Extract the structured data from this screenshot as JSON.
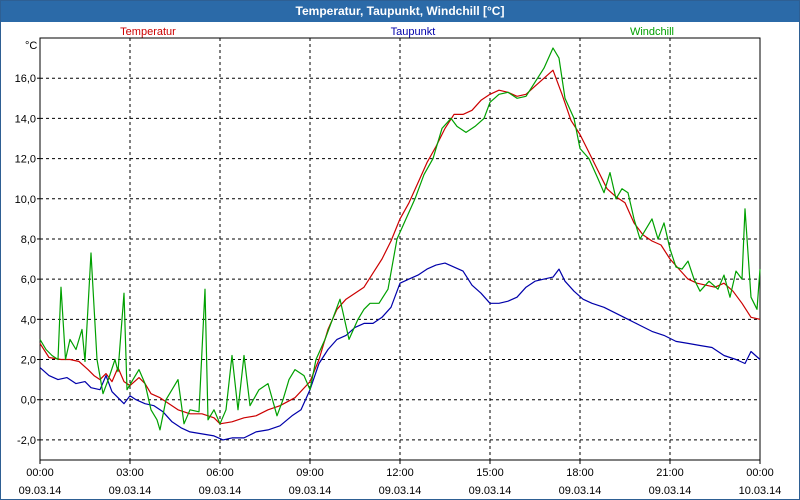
{
  "window": {
    "title": "Temperatur, Taupunkt, Windchill [°C]"
  },
  "chart_data": {
    "type": "line",
    "title": "Temperatur, Taupunkt, Windchill [°C]",
    "ylabel": "°C",
    "ylim": [
      -3,
      18
    ],
    "xlim": [
      0,
      24
    ],
    "yticks": [
      -2,
      0,
      2,
      4,
      6,
      8,
      10,
      12,
      14,
      16
    ],
    "ytick_labels": [
      "-2,0",
      "0,0",
      "2,0",
      "4,0",
      "6,0",
      "8,0",
      "10,0",
      "12,0",
      "14,0",
      "16,0"
    ],
    "xticks": [
      0,
      3,
      6,
      9,
      12,
      15,
      18,
      21,
      24
    ],
    "xtick_labels": [
      [
        "00:00",
        "09.03.14"
      ],
      [
        "03:00",
        "09.03.14"
      ],
      [
        "06:00",
        "09.03.14"
      ],
      [
        "09:00",
        "09.03.14"
      ],
      [
        "12:00",
        "09.03.14"
      ],
      [
        "15:00",
        "09.03.14"
      ],
      [
        "18:00",
        "09.03.14"
      ],
      [
        "21:00",
        "09.03.14"
      ],
      [
        "00:00",
        "10.03.14"
      ]
    ],
    "grid": true,
    "legend_position": "top",
    "series": [
      {
        "name": "Temperatur",
        "color": "#cc0000",
        "points": [
          [
            0,
            2.8
          ],
          [
            0.3,
            2.1
          ],
          [
            0.7,
            2.0
          ],
          [
            1.0,
            2.0
          ],
          [
            1.3,
            1.9
          ],
          [
            1.6,
            1.5
          ],
          [
            1.8,
            1.2
          ],
          [
            2.0,
            1.0
          ],
          [
            2.2,
            1.3
          ],
          [
            2.4,
            0.9
          ],
          [
            2.6,
            1.6
          ],
          [
            2.8,
            0.9
          ],
          [
            3.0,
            0.7
          ],
          [
            3.3,
            1.1
          ],
          [
            3.5,
            0.8
          ],
          [
            3.7,
            0.3
          ],
          [
            4.0,
            0.1
          ],
          [
            4.3,
            -0.2
          ],
          [
            4.6,
            -0.5
          ],
          [
            5.0,
            -0.7
          ],
          [
            5.4,
            -0.7
          ],
          [
            5.8,
            -0.9
          ],
          [
            6.0,
            -1.2
          ],
          [
            6.4,
            -1.1
          ],
          [
            6.8,
            -0.9
          ],
          [
            7.2,
            -0.8
          ],
          [
            7.6,
            -0.5
          ],
          [
            8.0,
            -0.3
          ],
          [
            8.5,
            0.1
          ],
          [
            9.0,
            0.9
          ],
          [
            9.3,
            2.0
          ],
          [
            9.6,
            3.5
          ],
          [
            9.9,
            4.5
          ],
          [
            10.2,
            5.0
          ],
          [
            10.5,
            5.3
          ],
          [
            10.8,
            5.6
          ],
          [
            11.1,
            6.3
          ],
          [
            11.4,
            7.0
          ],
          [
            11.7,
            7.9
          ],
          [
            12.0,
            9.0
          ],
          [
            12.3,
            9.8
          ],
          [
            12.6,
            10.8
          ],
          [
            12.9,
            11.8
          ],
          [
            13.2,
            12.6
          ],
          [
            13.5,
            13.5
          ],
          [
            13.8,
            14.2
          ],
          [
            14.1,
            14.2
          ],
          [
            14.4,
            14.4
          ],
          [
            14.7,
            14.9
          ],
          [
            15.0,
            15.2
          ],
          [
            15.3,
            15.4
          ],
          [
            15.6,
            15.3
          ],
          [
            15.9,
            15.1
          ],
          [
            16.2,
            15.2
          ],
          [
            16.5,
            15.6
          ],
          [
            16.8,
            16.0
          ],
          [
            17.1,
            16.4
          ],
          [
            17.4,
            15.2
          ],
          [
            17.7,
            13.9
          ],
          [
            18.0,
            13.2
          ],
          [
            18.3,
            12.3
          ],
          [
            18.6,
            11.4
          ],
          [
            18.9,
            10.5
          ],
          [
            19.2,
            10.1
          ],
          [
            19.5,
            9.8
          ],
          [
            19.8,
            8.8
          ],
          [
            20.1,
            8.2
          ],
          [
            20.4,
            7.9
          ],
          [
            20.7,
            7.7
          ],
          [
            21.0,
            7.0
          ],
          [
            21.3,
            6.5
          ],
          [
            21.6,
            6.0
          ],
          [
            21.9,
            5.8
          ],
          [
            22.2,
            5.7
          ],
          [
            22.5,
            5.6
          ],
          [
            22.8,
            5.8
          ],
          [
            23.1,
            5.4
          ],
          [
            23.4,
            4.8
          ],
          [
            23.7,
            4.1
          ],
          [
            24.0,
            4.0
          ]
        ]
      },
      {
        "name": "Taupunkt",
        "color": "#0000aa",
        "points": [
          [
            0,
            1.6
          ],
          [
            0.3,
            1.2
          ],
          [
            0.6,
            1.0
          ],
          [
            0.9,
            1.1
          ],
          [
            1.2,
            0.8
          ],
          [
            1.5,
            0.9
          ],
          [
            1.7,
            0.6
          ],
          [
            2.0,
            0.5
          ],
          [
            2.2,
            1.2
          ],
          [
            2.4,
            0.4
          ],
          [
            2.6,
            0.1
          ],
          [
            2.8,
            -0.2
          ],
          [
            3.0,
            0.2
          ],
          [
            3.2,
            0.0
          ],
          [
            3.5,
            -0.2
          ],
          [
            3.8,
            -0.3
          ],
          [
            4.1,
            -0.6
          ],
          [
            4.4,
            -1.1
          ],
          [
            4.7,
            -1.4
          ],
          [
            5.0,
            -1.6
          ],
          [
            5.4,
            -1.7
          ],
          [
            5.8,
            -1.8
          ],
          [
            6.1,
            -2.0
          ],
          [
            6.4,
            -1.9
          ],
          [
            6.8,
            -1.9
          ],
          [
            7.2,
            -1.6
          ],
          [
            7.6,
            -1.5
          ],
          [
            8.0,
            -1.3
          ],
          [
            8.4,
            -0.8
          ],
          [
            8.7,
            -0.5
          ],
          [
            9.0,
            0.5
          ],
          [
            9.3,
            1.8
          ],
          [
            9.6,
            2.5
          ],
          [
            9.9,
            3.0
          ],
          [
            10.2,
            3.2
          ],
          [
            10.5,
            3.6
          ],
          [
            10.8,
            3.8
          ],
          [
            11.1,
            3.8
          ],
          [
            11.4,
            4.1
          ],
          [
            11.7,
            4.6
          ],
          [
            12.0,
            5.8
          ],
          [
            12.3,
            6.0
          ],
          [
            12.6,
            6.2
          ],
          [
            12.9,
            6.5
          ],
          [
            13.2,
            6.7
          ],
          [
            13.5,
            6.8
          ],
          [
            13.8,
            6.6
          ],
          [
            14.1,
            6.4
          ],
          [
            14.4,
            5.7
          ],
          [
            14.7,
            5.3
          ],
          [
            15.0,
            4.8
          ],
          [
            15.3,
            4.8
          ],
          [
            15.6,
            4.9
          ],
          [
            15.9,
            5.1
          ],
          [
            16.2,
            5.6
          ],
          [
            16.5,
            5.9
          ],
          [
            16.8,
            6.0
          ],
          [
            17.1,
            6.1
          ],
          [
            17.3,
            6.5
          ],
          [
            17.5,
            5.9
          ],
          [
            17.8,
            5.4
          ],
          [
            18.1,
            5.0
          ],
          [
            18.4,
            4.8
          ],
          [
            18.8,
            4.6
          ],
          [
            19.2,
            4.3
          ],
          [
            19.6,
            4.0
          ],
          [
            20.0,
            3.7
          ],
          [
            20.4,
            3.4
          ],
          [
            20.8,
            3.2
          ],
          [
            21.2,
            2.9
          ],
          [
            21.6,
            2.8
          ],
          [
            22.0,
            2.7
          ],
          [
            22.4,
            2.6
          ],
          [
            22.8,
            2.2
          ],
          [
            23.2,
            2.0
          ],
          [
            23.5,
            1.8
          ],
          [
            23.7,
            2.4
          ],
          [
            24.0,
            2.0
          ]
        ]
      },
      {
        "name": "Windchill",
        "color": "#00a000",
        "points": [
          [
            0,
            3.0
          ],
          [
            0.2,
            2.5
          ],
          [
            0.4,
            2.2
          ],
          [
            0.6,
            2.0
          ],
          [
            0.7,
            5.6
          ],
          [
            0.85,
            2.0
          ],
          [
            1.0,
            3.0
          ],
          [
            1.2,
            2.5
          ],
          [
            1.4,
            3.5
          ],
          [
            1.5,
            1.9
          ],
          [
            1.7,
            7.3
          ],
          [
            1.9,
            2.0
          ],
          [
            2.1,
            0.3
          ],
          [
            2.3,
            1.1
          ],
          [
            2.5,
            2.0
          ],
          [
            2.6,
            1.4
          ],
          [
            2.8,
            5.3
          ],
          [
            2.9,
            0.5
          ],
          [
            3.1,
            1.0
          ],
          [
            3.3,
            1.5
          ],
          [
            3.5,
            0.8
          ],
          [
            3.7,
            -0.5
          ],
          [
            3.9,
            -1.0
          ],
          [
            4.0,
            -1.5
          ],
          [
            4.2,
            0.0
          ],
          [
            4.4,
            0.5
          ],
          [
            4.6,
            1.0
          ],
          [
            4.8,
            -1.2
          ],
          [
            5.0,
            -0.5
          ],
          [
            5.3,
            -0.6
          ],
          [
            5.5,
            5.5
          ],
          [
            5.6,
            -1.0
          ],
          [
            5.8,
            -0.5
          ],
          [
            6.0,
            -1.2
          ],
          [
            6.2,
            -0.5
          ],
          [
            6.4,
            2.2
          ],
          [
            6.6,
            -0.5
          ],
          [
            6.8,
            2.2
          ],
          [
            7.0,
            -0.3
          ],
          [
            7.3,
            0.5
          ],
          [
            7.6,
            0.8
          ],
          [
            7.9,
            -0.8
          ],
          [
            8.1,
            0.0
          ],
          [
            8.3,
            1.0
          ],
          [
            8.5,
            1.5
          ],
          [
            8.8,
            1.2
          ],
          [
            9.0,
            0.5
          ],
          [
            9.2,
            2.0
          ],
          [
            9.5,
            3.0
          ],
          [
            9.8,
            4.2
          ],
          [
            10.0,
            5.0
          ],
          [
            10.3,
            3.0
          ],
          [
            10.6,
            4.0
          ],
          [
            10.8,
            4.5
          ],
          [
            11.0,
            4.8
          ],
          [
            11.3,
            4.8
          ],
          [
            11.6,
            5.5
          ],
          [
            11.9,
            8.0
          ],
          [
            12.2,
            9.0
          ],
          [
            12.5,
            10.0
          ],
          [
            12.8,
            11.2
          ],
          [
            13.1,
            12.0
          ],
          [
            13.4,
            13.5
          ],
          [
            13.7,
            14.0
          ],
          [
            13.9,
            13.6
          ],
          [
            14.2,
            13.3
          ],
          [
            14.5,
            13.6
          ],
          [
            14.8,
            14.0
          ],
          [
            15.0,
            14.8
          ],
          [
            15.3,
            15.2
          ],
          [
            15.6,
            15.3
          ],
          [
            15.9,
            15.0
          ],
          [
            16.2,
            15.1
          ],
          [
            16.5,
            15.8
          ],
          [
            16.8,
            16.5
          ],
          [
            17.1,
            17.5
          ],
          [
            17.3,
            17.0
          ],
          [
            17.5,
            15.0
          ],
          [
            17.8,
            14.0
          ],
          [
            18.0,
            12.5
          ],
          [
            18.3,
            12.0
          ],
          [
            18.6,
            11.0
          ],
          [
            18.8,
            10.3
          ],
          [
            19.0,
            11.3
          ],
          [
            19.2,
            10.0
          ],
          [
            19.4,
            10.5
          ],
          [
            19.6,
            10.3
          ],
          [
            19.8,
            9.0
          ],
          [
            20.0,
            8.0
          ],
          [
            20.2,
            8.5
          ],
          [
            20.4,
            9.0
          ],
          [
            20.6,
            8.0
          ],
          [
            20.8,
            8.8
          ],
          [
            21.0,
            7.5
          ],
          [
            21.2,
            6.6
          ],
          [
            21.4,
            6.5
          ],
          [
            21.6,
            6.9
          ],
          [
            21.8,
            6.0
          ],
          [
            22.0,
            5.4
          ],
          [
            22.3,
            5.9
          ],
          [
            22.6,
            5.5
          ],
          [
            22.8,
            6.2
          ],
          [
            23.0,
            5.1
          ],
          [
            23.2,
            6.4
          ],
          [
            23.4,
            6.0
          ],
          [
            23.5,
            9.5
          ],
          [
            23.7,
            5.1
          ],
          [
            23.9,
            4.5
          ],
          [
            24.0,
            6.5
          ]
        ]
      }
    ]
  }
}
